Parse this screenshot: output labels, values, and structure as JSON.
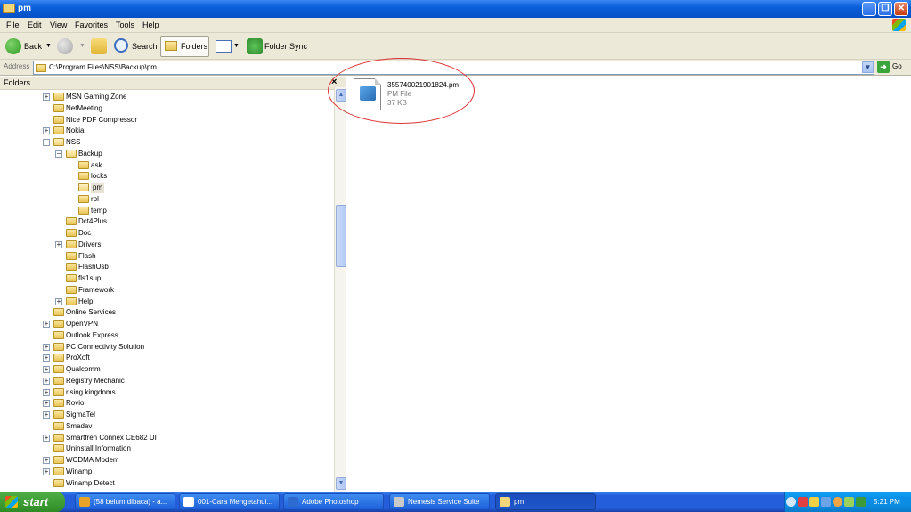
{
  "window": {
    "title": "pm"
  },
  "menu": [
    "File",
    "Edit",
    "View",
    "Favorites",
    "Tools",
    "Help"
  ],
  "toolbar": {
    "back": "Back",
    "search": "Search",
    "folders": "Folders",
    "folder_sync": "Folder Sync"
  },
  "address": {
    "label": "Address",
    "value": "C:\\Program Files\\NSS\\Backup\\pm",
    "go": "Go"
  },
  "folders_pane": {
    "title": "Folders",
    "close": "×",
    "tree": [
      {
        "label": "MSN Gaming Zone",
        "expander": "+"
      },
      {
        "label": "NetMeeting",
        "expander": ""
      },
      {
        "label": "Nice PDF Compressor",
        "expander": ""
      },
      {
        "label": "Nokia",
        "expander": "+"
      },
      {
        "label": "NSS",
        "expander": "−"
      },
      {
        "label": "Backup",
        "expander": "−"
      },
      {
        "label": "ask",
        "expander": ""
      },
      {
        "label": "locks",
        "expander": ""
      },
      {
        "label": "pm",
        "expander": ""
      },
      {
        "label": "rpl",
        "expander": ""
      },
      {
        "label": "temp",
        "expander": ""
      },
      {
        "label": "Dct4Plus",
        "expander": ""
      },
      {
        "label": "Doc",
        "expander": ""
      },
      {
        "label": "Drivers",
        "expander": "+"
      },
      {
        "label": "Flash",
        "expander": ""
      },
      {
        "label": "FlashUsb",
        "expander": ""
      },
      {
        "label": "fls1sup",
        "expander": ""
      },
      {
        "label": "Framework",
        "expander": ""
      },
      {
        "label": "Help",
        "expander": "+"
      },
      {
        "label": "Online Services",
        "expander": ""
      },
      {
        "label": "OpenVPN",
        "expander": "+"
      },
      {
        "label": "Outlook Express",
        "expander": ""
      },
      {
        "label": "PC Connectivity Solution",
        "expander": "+"
      },
      {
        "label": "ProXoft",
        "expander": "+"
      },
      {
        "label": "Qualcomm",
        "expander": "+"
      },
      {
        "label": "Registry Mechanic",
        "expander": "+"
      },
      {
        "label": "rising kingdoms",
        "expander": "+"
      },
      {
        "label": "Rovio",
        "expander": "+"
      },
      {
        "label": "SigmaTel",
        "expander": "+"
      },
      {
        "label": "Smadav",
        "expander": ""
      },
      {
        "label": "Smartfren Connex CE682 UI",
        "expander": "+"
      },
      {
        "label": "Uninstall Information",
        "expander": ""
      },
      {
        "label": "WCDMA Modem",
        "expander": "+"
      },
      {
        "label": "Winamp",
        "expander": "+"
      },
      {
        "label": "Winamp Detect",
        "expander": ""
      }
    ],
    "selected": "pm"
  },
  "file": {
    "name": "355740021901824.pm",
    "type": "PM File",
    "size": "37 KB"
  },
  "taskbar": {
    "start": "start",
    "tasks": [
      {
        "label": "(58 belum dibaca) - a...",
        "icon_color": "#e9a329"
      },
      {
        "label": "001-Cara Mengetahui...",
        "icon_color": "#ffffff"
      },
      {
        "label": "Adobe Photoshop",
        "icon_color": "#2d6bd0"
      },
      {
        "label": "Nemesis Service Suite",
        "icon_color": "#c9c9c9"
      },
      {
        "label": "pm",
        "icon_color": "#f3d57a"
      }
    ],
    "clock": "5:21 PM"
  }
}
